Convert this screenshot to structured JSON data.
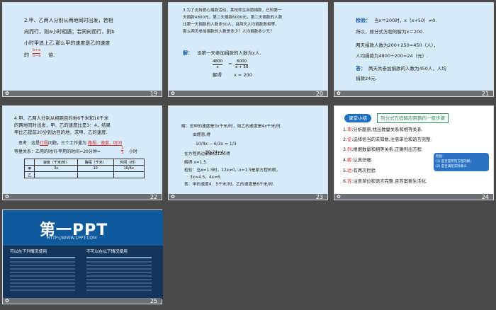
{
  "slides": [
    {
      "number": "19",
      "lines": [
        "2.甲、乙两人分别从两地同时出发，若相",
        "向而行，则a小时相遇；若同向而行，则b",
        "小时甲追上乙.那么甲的速度是乙的速度",
        "的",
        "倍."
      ],
      "fraction": {
        "num": "b+a",
        "den": "b−a"
      }
    },
    {
      "number": "20",
      "lines": [
        "3.为了支持爱心捐款活动，某校师生自愿捐款，已知第一",
        "天捐款4800元，第二天捐款6000元，第二天捐款的人数",
        "比第一天捐款的人数多50人，且两天人均捐款数相等，",
        "那么两天参加捐款的人数是多少？人均捐款多少元？"
      ],
      "answer_label": "解：",
      "answer_text": "设第一天参加捐款的人数为x人.",
      "eq_left_num": "4800",
      "eq_left_den": "x",
      "eq_right_num": "6000",
      "eq_right_den": "x + 50",
      "solve_label": "解得",
      "solve_value": "x = 200"
    },
    {
      "number": "21",
      "check_label": "检验：",
      "check_text": "当x＝200时，x（x+50）≠0.",
      "line2": "所以，原分式方程的解为x＝200.",
      "line3": "两天捐款人数为200+250=450（人），",
      "line4": "人均捐款为4800÷200=24（元）.",
      "answer_label": "答：",
      "answer_text": "两天共参加捐款的人数为450人，人均",
      "answer_text2": "捐款24元."
    },
    {
      "number": "22",
      "lines": [
        "4.甲、乙两人分别从相距目的地6千米和10千米",
        "的两地同时出发，甲、乙的速度比是3：4，结果",
        "甲比乙提前20分到达目的地．求甲、乙的速度."
      ],
      "think_prefix": "思考：这是",
      "think_keyword": "行程",
      "think_middle": "问题，三个工作量为",
      "think_terms": "路程、速度、时间",
      "eq_line": "等量关系：乙用的时间-甲用的时间=20分钟=",
      "eq_frac": {
        "num": "1",
        "den": "3"
      },
      "eq_unit": "小时",
      "table_headers": [
        "",
        "速度（千米/时）",
        "路程（千米）",
        "时间（时）"
      ],
      "table_rows": [
        [
          "甲",
          "3x",
          "10",
          "10/4x"
        ],
        [
          "乙",
          "",
          "",
          ""
        ]
      ]
    },
    {
      "number": "23",
      "line1": "解：设甲的速度是3x千米/时，则乙的速度是4x千米/时.",
      "line2": "由题意,得",
      "eq": "10/4x − 6/3x = 1/3",
      "line3": "30-24=4x",
      "line4": "在方程两边都乘以12x,得",
      "line5": "解得              x=1.5.",
      "line6": "检验：当x=1.5时，12x≠0,∴x=1.5是原方程的根，",
      "line7": "3x=4.5，4x=6.",
      "line8": "答：甲的速度4．5千米/时，乙的速度是6千米/时."
    },
    {
      "number": "24",
      "badge": "课堂小结",
      "heading": "列分式方程解应用题的一般步骤",
      "steps": [
        {
          "no": "1.",
          "key": "审",
          "text": ":分析题意,找出数量关系和相等关系."
        },
        {
          "no": "2.",
          "key": "设",
          "text": ":选择恰当的未知数,注意单位和语言完整."
        },
        {
          "no": "3.",
          "key": "列",
          "text": ":根据数量和相等关系,正确列出方程."
        },
        {
          "no": "4.",
          "key": "解",
          "text": ":认真仔细."
        },
        {
          "no": "5.",
          "key": "验",
          "text": ":有两次检验."
        },
        {
          "no": "6.",
          "key": "答",
          "text": ":注意单位和语言完整.且答案要生活化."
        }
      ],
      "callout_title": "检验：",
      "callout_lines": [
        "(1) 是否是所列方程的解；",
        "(2) 是否满足实际意义."
      ]
    },
    {
      "number": "25",
      "logo": "第一PPT",
      "url": "HTTP://WWW.1PPT.COM",
      "left_title": "可以在下列情况使用",
      "right_title": "不可以在以下情况使用"
    }
  ]
}
